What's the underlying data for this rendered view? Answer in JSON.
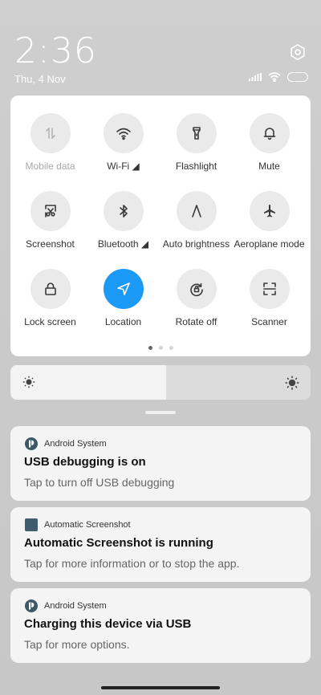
{
  "status": {
    "time": "2:36",
    "date": "Thu, 4 Nov",
    "icons": [
      "signal-icon",
      "wifi-icon",
      "battery-icon"
    ]
  },
  "quick_settings": {
    "tiles": [
      {
        "label": "Mobile data",
        "icon": "mobile-data-icon",
        "state": "disabled"
      },
      {
        "label": "Wi-Fi ◢",
        "icon": "wifi-icon",
        "state": "off"
      },
      {
        "label": "Flashlight",
        "icon": "flashlight-icon",
        "state": "off"
      },
      {
        "label": "Mute",
        "icon": "bell-icon",
        "state": "off"
      },
      {
        "label": "Screenshot",
        "icon": "screenshot-icon",
        "state": "off"
      },
      {
        "label": "Bluetooth ◢",
        "icon": "bluetooth-icon",
        "state": "off"
      },
      {
        "label": "Auto brightness",
        "icon": "auto-brightness-icon",
        "state": "off"
      },
      {
        "label": "Aeroplane mode",
        "icon": "airplane-icon",
        "state": "off"
      },
      {
        "label": "Lock screen",
        "icon": "lock-icon",
        "state": "off"
      },
      {
        "label": "Location",
        "icon": "location-icon",
        "state": "on"
      },
      {
        "label": "Rotate off",
        "icon": "rotate-lock-icon",
        "state": "off"
      },
      {
        "label": "Scanner",
        "icon": "scanner-icon",
        "state": "off"
      }
    ],
    "pages": 3,
    "current_page": 1
  },
  "brightness": {
    "level": 0.52
  },
  "notifications": [
    {
      "app": "Android System",
      "title": "USB debugging is on",
      "body": "Tap to turn off USB debugging",
      "icon": "android-system-icon"
    },
    {
      "app": "Automatic Screenshot",
      "title": "Automatic Screenshot is running",
      "body": "Tap for more information or to stop the app.",
      "icon": "app-square-icon"
    },
    {
      "app": "Android System",
      "title": "Charging this device via USB",
      "body": "Tap for more options.",
      "icon": "android-system-icon"
    }
  ],
  "colors": {
    "accent": "#1a99f5",
    "tile_bg": "#eaeaea",
    "panel_bg": "#ffffff"
  }
}
